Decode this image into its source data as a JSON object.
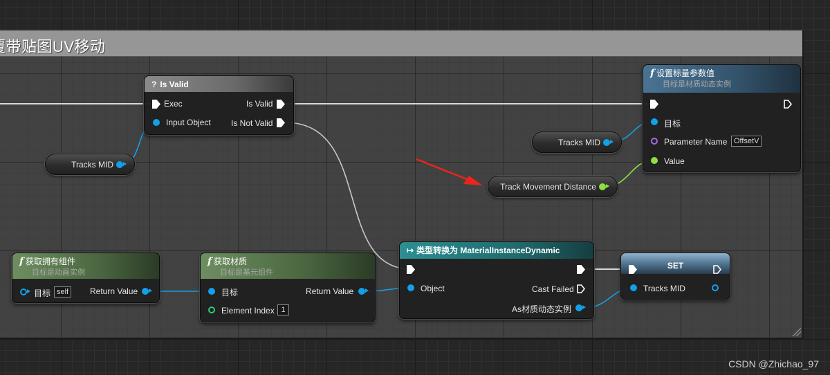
{
  "comment": {
    "title": "覆带贴图UV移动"
  },
  "is_valid_node": {
    "title": "Is Valid",
    "icon": "question-icon",
    "pins": {
      "exec": "Exec",
      "input_object": "Input Object",
      "is_valid": "Is Valid",
      "is_not_valid": "Is Not Valid"
    }
  },
  "tracks_mid_get_1": {
    "label": "Tracks MID"
  },
  "tracks_mid_get_2": {
    "label": "Tracks MID"
  },
  "track_movement_distance": {
    "label": "Track Movement Distance"
  },
  "set_scalar_node": {
    "title": "设置标量参数值",
    "subtitle": "目标是材质动态实例",
    "pins": {
      "target": "目标",
      "parameter_name": "Parameter Name",
      "parameter_value": "OffsetV",
      "value": "Value"
    }
  },
  "get_owner_node": {
    "title": "获取拥有组件",
    "subtitle": "目标是动画实例",
    "pins": {
      "target": "目标",
      "target_value": "self",
      "return_value": "Return Value"
    }
  },
  "get_material_node": {
    "title": "获取材质",
    "subtitle": "目标是基元组件",
    "pins": {
      "target": "目标",
      "element_index": "Element Index",
      "element_index_value": "1",
      "return_value": "Return Value"
    }
  },
  "cast_node": {
    "title": "类型转换为 MaterialInstanceDynamic",
    "pins": {
      "object": "Object",
      "cast_failed": "Cast Failed",
      "as_output": "As材质动态实例"
    }
  },
  "set_node": {
    "title": "SET",
    "pins": {
      "tracks_mid": "Tracks MID"
    }
  },
  "watermark": "CSDN @Zhichao_97",
  "colors": {
    "object_pin": "#13a0e8",
    "float_pin": "#8de041",
    "int_pin": "#30c979",
    "name_pin": "#a76ae0",
    "function_header": "#3b5f79",
    "pure_function_header": "#506e44",
    "cast_header": "#1f6b6e",
    "annotation_arrow": "#e8261c"
  }
}
